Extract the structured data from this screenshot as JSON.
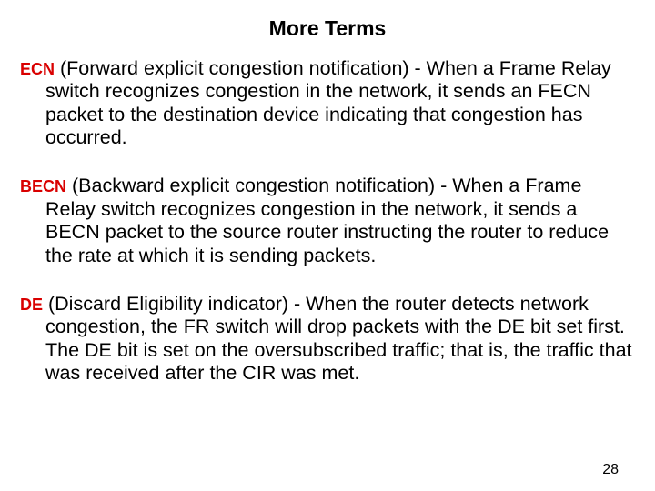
{
  "title": "More Terms",
  "items": [
    {
      "acr": "ECN",
      "text": " (Forward explicit congestion notification) - When a Frame Relay switch recognizes congestion in the network, it sends an FECN packet to the destination device indicating that congestion has occurred."
    },
    {
      "acr": "BECN",
      "text": " (Backward explicit congestion notification) - When a Frame Relay switch recognizes congestion in the network, it sends a BECN packet to the source router instructing the router to reduce the rate at which it is sending packets."
    },
    {
      "acr": "DE",
      "text": " (Discard Eligibility indicator) - When the router detects network congestion, the FR switch will drop packets with the DE bit set first. The DE bit is set on the oversubscribed traffic; that is, the traffic that was received after the CIR was met."
    }
  ],
  "page_number": "28"
}
